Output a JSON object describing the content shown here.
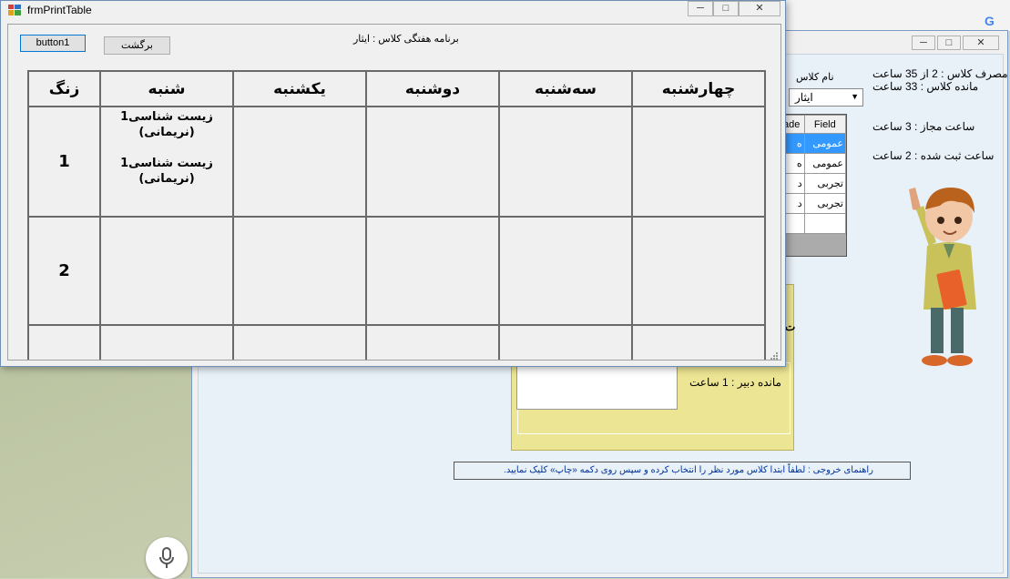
{
  "background": {
    "google_icon": "G"
  },
  "back_window": {
    "usage_line": "مصرف کلاس : 2 از 35 ساعت",
    "remaining_line": "مانده کلاس : 33 ساعت",
    "allowed_hours": "ساعت مجاز : 3 ساعت",
    "registered_hours": "ساعت ثبت شده : 2 ساعت",
    "class_name_label": "نام کلاس",
    "class_combo_value": "ایثار",
    "grid_headers": [
      "rade",
      "Field"
    ],
    "grid_rows": [
      [
        "ه",
        "عمومی"
      ],
      [
        "ه",
        "عمومی"
      ],
      [
        "د",
        "تجربی"
      ],
      [
        "د",
        "تجربی"
      ]
    ],
    "teacher_remaining": "مانده دبیر : 1 ساعت",
    "yellow_label_fragment": "ت",
    "guide_text": "راهنمای خروجی : لطفاً ابتدا کلاس مورد نظر را انتخاب کرده و سپس روی دکمه «چاپ» کلیک نمایید."
  },
  "front_window": {
    "title": "frmPrintTable",
    "button1_label": "button1",
    "back_button_label": "برگشت",
    "heading": "برنامه هفتگی کلاس : ایثار",
    "columns": [
      "زنگ",
      "شنبه",
      "یکشنبه",
      "دوشنبه",
      "سه‌شنبه",
      "چهارشنبه"
    ],
    "rows": [
      {
        "bell": "1",
        "saturday": [
          "زیست شناسی1",
          "(نریمانی)",
          "زیست شناسی1",
          "(نریمانی)"
        ]
      },
      {
        "bell": "2",
        "saturday": []
      },
      {
        "bell": "",
        "saturday": []
      }
    ]
  },
  "colors": {
    "window_border": "#6d8fb5",
    "selection": "#3399ff",
    "yellow_panel": "#ece593",
    "guide_text": "#003399"
  }
}
